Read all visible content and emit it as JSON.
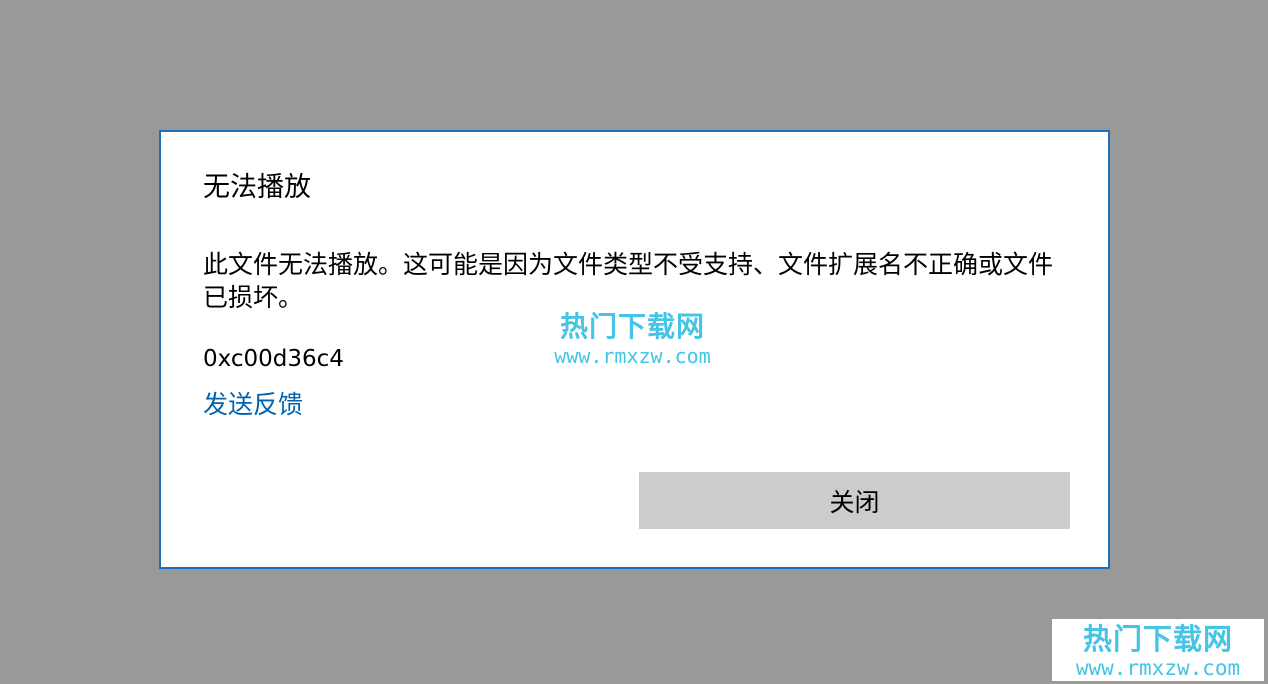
{
  "dialog": {
    "title": "无法播放",
    "message": "此文件无法播放。这可能是因为文件类型不受支持、文件扩展名不正确或文件已损坏。",
    "error_code": "0xc00d36c4",
    "feedback_link": "发送反馈",
    "close_button": "关闭"
  },
  "watermark": {
    "name": "热门下载网",
    "url": "www.rmxzw.com"
  },
  "colors": {
    "backdrop": "#999999",
    "dialog_border": "#1e6fb5",
    "link": "#0063b1",
    "button": "#cccccc",
    "watermark": "#45c4e6"
  }
}
